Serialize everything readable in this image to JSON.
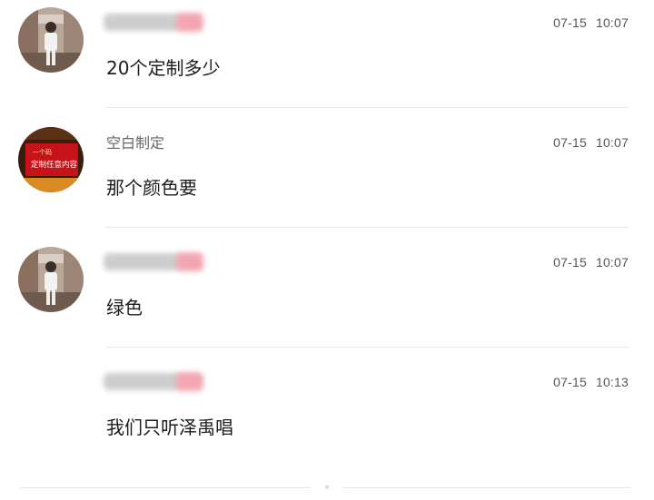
{
  "comments": [
    {
      "avatar": "user-photo-avatar",
      "name": "",
      "name_hidden": true,
      "date": "07-15",
      "time": "10:07",
      "text": "20个定制多少"
    },
    {
      "avatar": "red-banner-avatar",
      "avatar_banner_top": "一个码",
      "avatar_banner_main": "定制任意内容",
      "name": "空白制定",
      "name_hidden": false,
      "date": "07-15",
      "time": "10:07",
      "text": "那个颜色要"
    },
    {
      "avatar": "user-photo-avatar",
      "name": "",
      "name_hidden": true,
      "date": "07-15",
      "time": "10:07",
      "text": "绿色"
    },
    {
      "avatar": "",
      "name": "",
      "name_hidden": true,
      "date": "07-15",
      "time": "10:13",
      "text": "我们只听泽禹唱"
    }
  ],
  "colors": {
    "blur_grey": "#cdcdcd",
    "blur_pink": "#f3a6b1",
    "avatar_red": "#c8121a",
    "divider": "#e8e8e8"
  }
}
